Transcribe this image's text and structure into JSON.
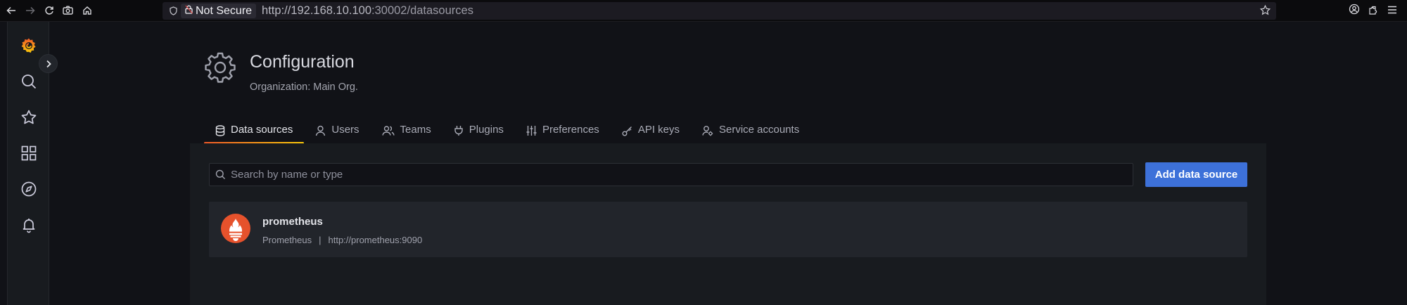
{
  "browser": {
    "security_label": "Not Secure",
    "url_host": "http://192.168.10.100",
    "url_path": ":30002/datasources"
  },
  "sidebar": {
    "items": [
      {
        "icon": "grafana-logo-icon"
      },
      {
        "icon": "search-icon"
      },
      {
        "icon": "star-icon"
      },
      {
        "icon": "dashboards-grid-icon"
      },
      {
        "icon": "explore-compass-icon"
      },
      {
        "icon": "alerting-bell-icon"
      }
    ]
  },
  "header": {
    "title": "Configuration",
    "subtitle": "Organization: Main Org."
  },
  "tabs": [
    {
      "label": "Data sources",
      "icon": "database-icon",
      "active": true
    },
    {
      "label": "Users",
      "icon": "user-icon",
      "active": false
    },
    {
      "label": "Teams",
      "icon": "users-icon",
      "active": false
    },
    {
      "label": "Plugins",
      "icon": "plug-icon",
      "active": false
    },
    {
      "label": "Preferences",
      "icon": "sliders-icon",
      "active": false
    },
    {
      "label": "API keys",
      "icon": "key-icon",
      "active": false
    },
    {
      "label": "Service accounts",
      "icon": "user-cog-icon",
      "active": false
    }
  ],
  "search": {
    "placeholder": "Search by name or type",
    "value": ""
  },
  "actions": {
    "add_label": "Add data source"
  },
  "datasources": [
    {
      "name": "prometheus",
      "type": "Prometheus",
      "separator": "|",
      "url": "http://prometheus:9090",
      "logo_color": "#e6522c"
    }
  ],
  "colors": {
    "accent": "#3d71d9",
    "tab_underline_start": "#f05a28",
    "tab_underline_end": "#fbca0a",
    "background": "#111217",
    "panel": "#181b1f"
  }
}
